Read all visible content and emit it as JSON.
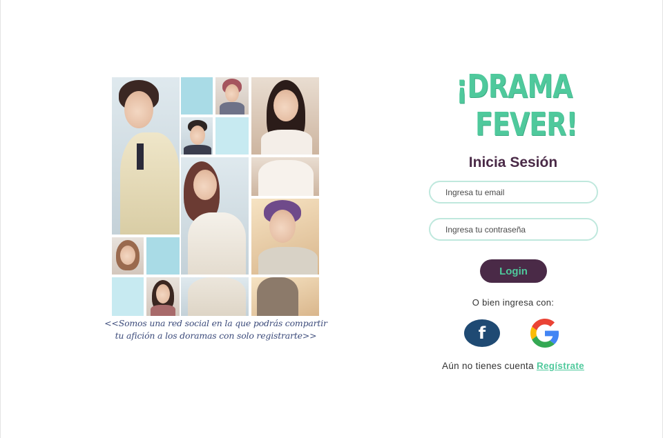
{
  "collage": {
    "caption_line1": "<<Somos una red social en la que podrás compartir",
    "caption_line2": "tu afición a los doramas con solo registrarte>>",
    "accent_color": "#a9dbe6"
  },
  "brand": {
    "logo_line1": "¡DRAMA",
    "logo_line2": "FEVER!",
    "logo_color": "#4fc99c"
  },
  "login": {
    "title": "Inicia Sesión",
    "email_placeholder": "Ingresa tu email",
    "password_placeholder": "Ingresa tu contraseña",
    "login_label": "Login",
    "alt_text": "O bien ingresa con:",
    "facebook_glyph": "f",
    "facebook_icon": "facebook-icon",
    "google_icon": "google-icon",
    "no_account_text": "Aún no tienes cuenta ",
    "signup_label": "Regístrate",
    "primary_color": "#4a2a47"
  }
}
